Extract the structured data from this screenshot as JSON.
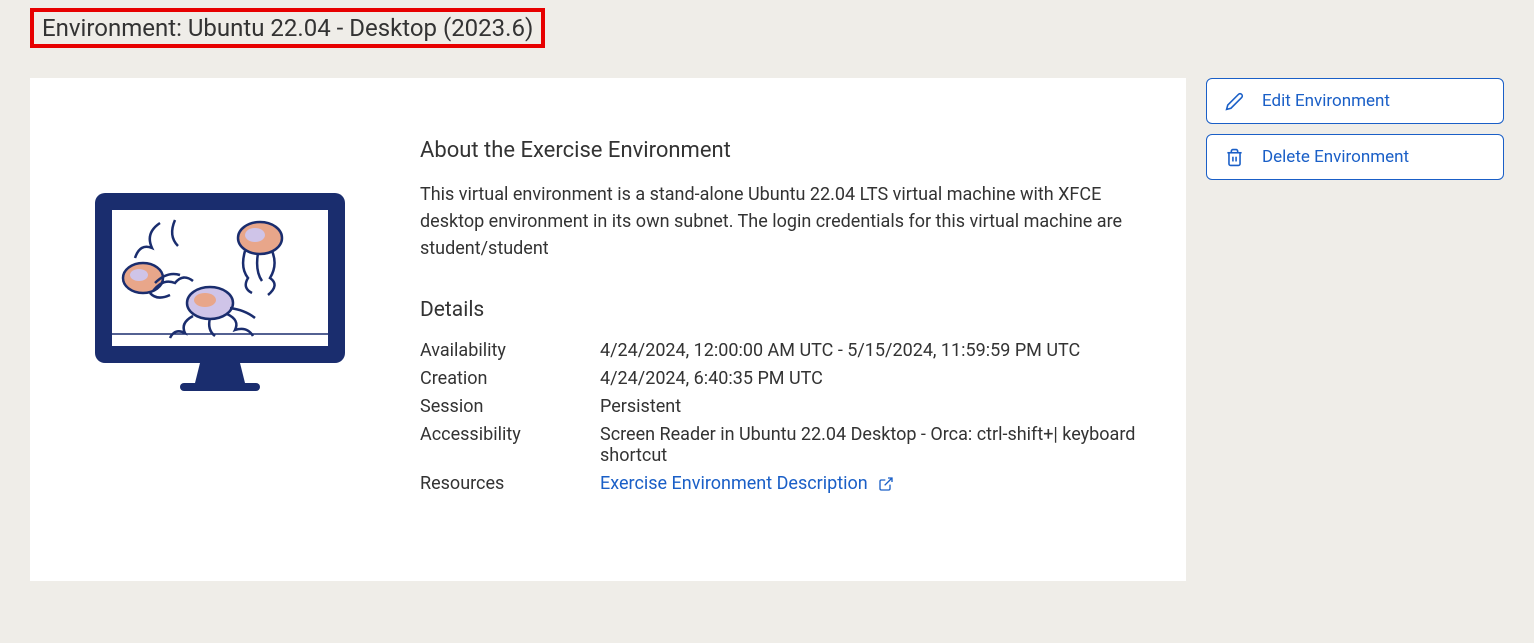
{
  "header": {
    "title": "Environment: Ubuntu 22.04 - Desktop (2023.6)"
  },
  "main": {
    "about": {
      "heading": "About the Exercise Environment",
      "text": "This virtual environment is a stand-alone Ubuntu 22.04 LTS virtual machine with XFCE desktop environment in its own subnet. The login credentials for this virtual machine are student/student"
    },
    "details": {
      "heading": "Details",
      "rows": [
        {
          "label": "Availability",
          "value": "4/24/2024, 12:00:00 AM UTC - 5/15/2024, 11:59:59 PM UTC"
        },
        {
          "label": "Creation",
          "value": "4/24/2024, 6:40:35 PM UTC"
        },
        {
          "label": "Session",
          "value": "Persistent"
        },
        {
          "label": "Accessibility",
          "value": "Screen Reader in Ubuntu 22.04 Desktop - Orca: ctrl-shift+| keyboard shortcut"
        }
      ],
      "resources": {
        "label": "Resources",
        "link_text": "Exercise Environment Description"
      }
    }
  },
  "sidebar": {
    "edit_label": "Edit Environment",
    "delete_label": "Delete Environment"
  },
  "colors": {
    "accent": "#1a5fc7",
    "highlight_border": "#e70000",
    "bg": "#efede8"
  }
}
